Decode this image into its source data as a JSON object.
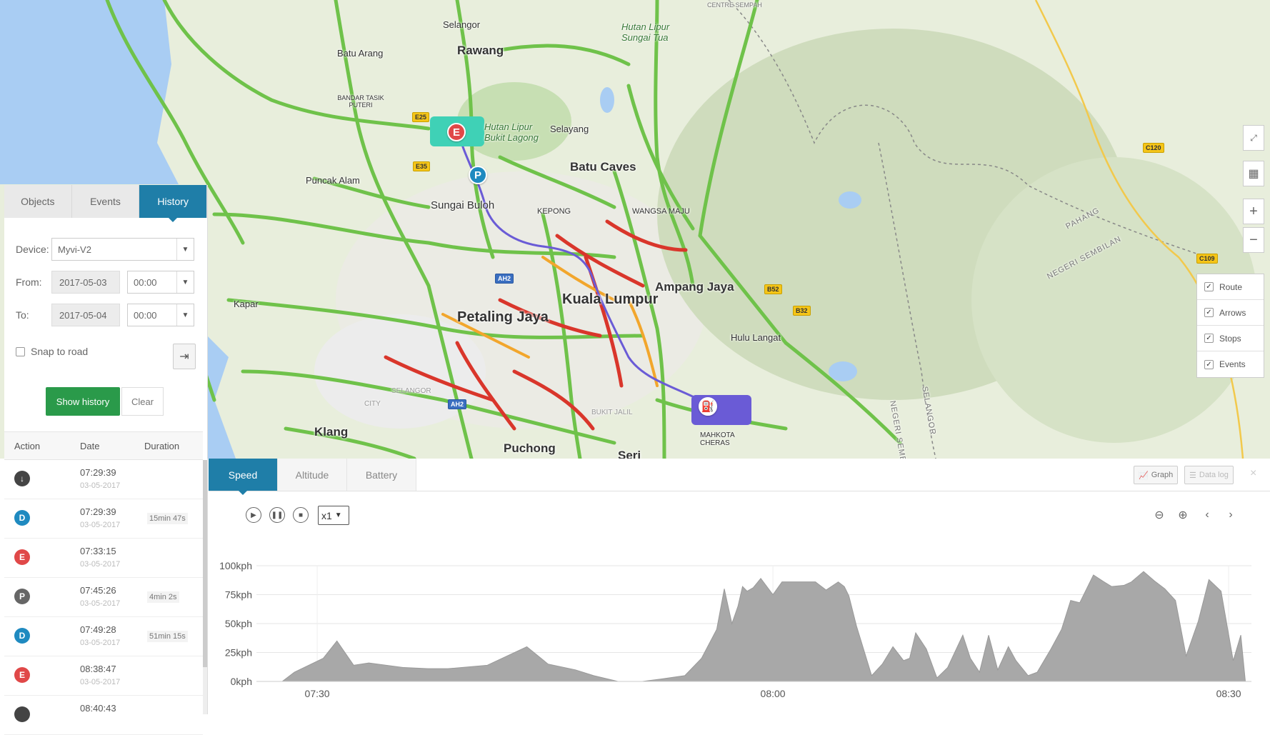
{
  "map": {
    "labels": {
      "rawang": "Rawang",
      "selangor": "Selangor",
      "batu_arang": "Batu Arang",
      "bandar_tasik_puteri": "BANDAR TASIK PUTERI",
      "hutan_bukit_lagong": "Hutan Lipur Bukit Lagong",
      "hutan_sungai_tua": "Hutan Lipur Sungai Tua",
      "selayang": "Selayang",
      "batu_caves": "Batu Caves",
      "puncak_alam": "Puncak Alam",
      "sungai_buloh": "Sungai Buloh",
      "kepong": "KEPONG",
      "wangsa_maju": "WANGSA MAJU",
      "ampang_jaya": "Ampang Jaya",
      "kuala_lumpur": "Kuala Lumpur",
      "petaling_jaya": "Petaling Jaya",
      "kapar": "Kapar",
      "hulu_langat": "Hulu Langat",
      "klang": "Klang",
      "puchong": "Puchong",
      "selangor_area": "SELANGOR",
      "bukit_jalil": "BUKIT JALIL",
      "mahkota_cheras": "MAHKOTA CHERAS",
      "seri": "Seri",
      "pahang": "PAHANG",
      "negeri_sembilan": "NEGERI SEMBILAN",
      "negeri_sembilan_v": "NEGERI SEMBILAN",
      "selangor_v": "SELANGOR",
      "city": "CITY",
      "centre_semenyih": "CENTRE SEMPAH"
    },
    "markers": {
      "end": "E",
      "park": "P"
    },
    "controls": {
      "fullscreen_icon": "expand-icon",
      "layers_icon": "map-icon",
      "zoom_in": "+",
      "zoom_out": "−"
    },
    "layers": [
      {
        "label": "Route",
        "checked": true
      },
      {
        "label": "Arrows",
        "checked": true
      },
      {
        "label": "Stops",
        "checked": true
      },
      {
        "label": "Events",
        "checked": true
      }
    ]
  },
  "sidebar": {
    "tabs": [
      {
        "label": "Objects"
      },
      {
        "label": "Events"
      },
      {
        "label": "History",
        "active": true
      }
    ],
    "device_label": "Device:",
    "device_value": "Myvi-V2",
    "from_label": "From:",
    "from_date": "2017-05-03",
    "from_time": "00:00",
    "to_label": "To:",
    "to_date": "2017-05-04",
    "to_time": "00:00",
    "snap_label": "Snap to road",
    "show_history": "Show history",
    "clear": "Clear",
    "history_headers": {
      "action": "Action",
      "date": "Date",
      "duration": "Duration"
    },
    "history": [
      {
        "icon": "↓",
        "color": "#444444",
        "time": "07:29:39",
        "date": "03-05-2017",
        "duration": ""
      },
      {
        "icon": "D",
        "color": "#1f8ac0",
        "time": "07:29:39",
        "date": "03-05-2017",
        "duration": "15min 47s"
      },
      {
        "icon": "E",
        "color": "#e04848",
        "time": "07:33:15",
        "date": "03-05-2017",
        "duration": ""
      },
      {
        "icon": "P",
        "color": "#666666",
        "time": "07:45:26",
        "date": "03-05-2017",
        "duration": "4min 2s"
      },
      {
        "icon": "D",
        "color": "#1f8ac0",
        "time": "07:49:28",
        "date": "03-05-2017",
        "duration": "51min 15s"
      },
      {
        "icon": "E",
        "color": "#e04848",
        "time": "08:38:47",
        "date": "03-05-2017",
        "duration": ""
      },
      {
        "icon": "",
        "color": "#444444",
        "time": "08:40:43",
        "date": "",
        "duration": ""
      }
    ]
  },
  "graph": {
    "tabs": [
      {
        "label": "Speed",
        "active": true
      },
      {
        "label": "Altitude"
      },
      {
        "label": "Battery"
      }
    ],
    "graph_btn": "Graph",
    "datalog_btn": "Data log",
    "close": "×",
    "playback_speed": "x1",
    "controls": {
      "play": "play-icon",
      "pause": "pause-icon",
      "stop": "stop-icon"
    },
    "zoom_controls": {
      "zoom_out": "zoom-out-icon",
      "zoom_in": "zoom-in-icon",
      "prev": "prev-icon",
      "next": "next-icon"
    }
  },
  "chart_data": {
    "type": "area",
    "y_ticks": [
      "100kph",
      "75kph",
      "50kph",
      "25kph",
      "0kph"
    ],
    "x_ticks": [
      "07:30",
      "08:00",
      "08:30"
    ],
    "ylim": [
      0,
      100
    ],
    "x_minutes_range": [
      7.25,
      8.9
    ],
    "series": [
      {
        "values_note_x": "minutes after 07:00, y in kph",
        "x": [
          27.7,
          28.5,
          30.4,
          31.3,
          32.4,
          33.4,
          35.7,
          37.3,
          38.6,
          41.2,
          43.8,
          45.2,
          47.0,
          48.2,
          49.8,
          51.4,
          52.6,
          54.2,
          55.3,
          56.3,
          56.8,
          57.3,
          57.7,
          58.0,
          58.3,
          58.7,
          59.2,
          60.0,
          60.6,
          61.7,
          62.0,
          62.8,
          63.5,
          64.3,
          64.7,
          65.0,
          65.5,
          66.5,
          67.2,
          67.9,
          68.6,
          69.0,
          69.4,
          70.1,
          70.8,
          71.5,
          72.5,
          73.0,
          73.6,
          74.2,
          74.8,
          75.5,
          76.0,
          76.8,
          77.4,
          78.3,
          79.0,
          79.6,
          80.2,
          81.1,
          81.8,
          82.3,
          83.1,
          83.6,
          84.4,
          85.1,
          85.8,
          86.5,
          87.2,
          88.0,
          88.7,
          89.5,
          90.3,
          90.8,
          91.1
        ],
        "y": [
          0,
          8,
          20,
          35,
          14,
          16,
          12,
          11,
          11,
          14,
          30,
          15,
          10,
          5,
          0,
          0,
          2,
          5,
          20,
          45,
          80,
          50,
          65,
          82,
          78,
          81,
          89,
          75,
          86,
          86,
          86,
          86,
          79,
          86,
          82,
          74,
          48,
          5,
          15,
          30,
          18,
          20,
          42,
          28,
          3,
          12,
          40,
          20,
          8,
          40,
          10,
          30,
          18,
          5,
          8,
          28,
          45,
          70,
          68,
          92,
          86,
          82,
          83,
          86,
          95,
          87,
          80,
          70,
          22,
          52,
          88,
          78,
          18,
          40,
          0
        ]
      }
    ]
  }
}
